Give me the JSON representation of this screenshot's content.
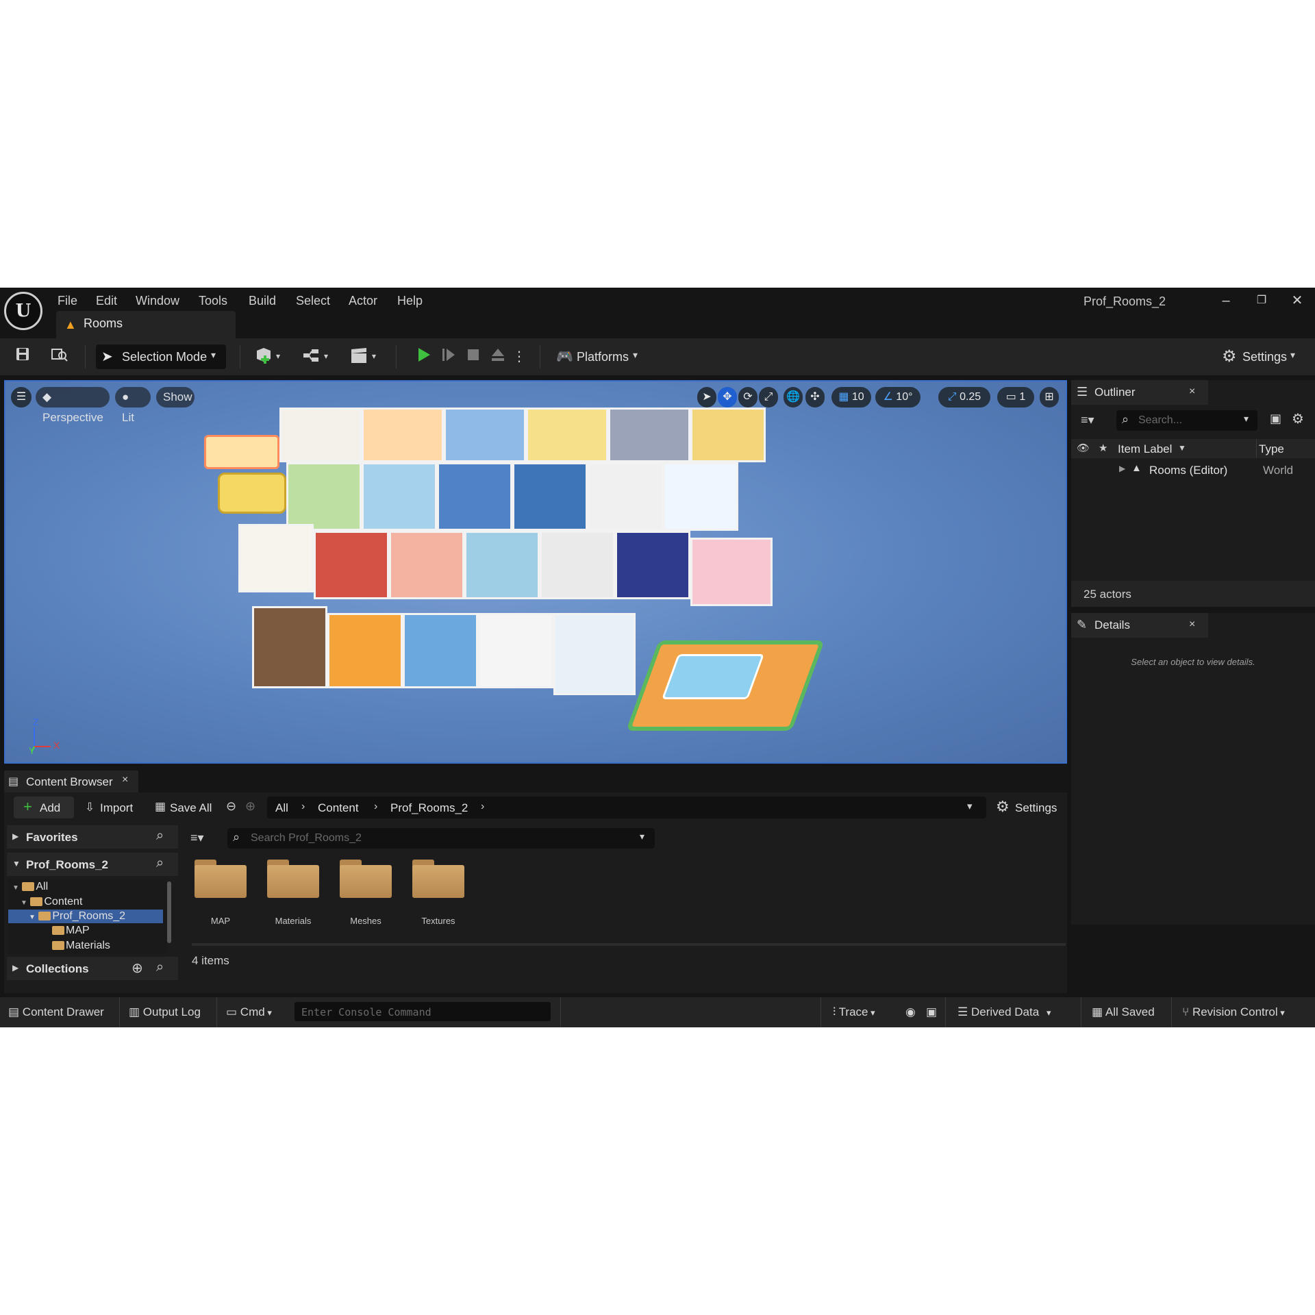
{
  "menu": {
    "items": [
      "File",
      "Edit",
      "Window",
      "Tools",
      "Build",
      "Select",
      "Actor",
      "Help"
    ]
  },
  "map_tab": {
    "label": "Rooms"
  },
  "window_title": "Prof_Rooms_2",
  "window_controls": {
    "minimize": "–",
    "restore": "❐",
    "close": "✕"
  },
  "toolbar": {
    "selection_mode": "Selection Mode",
    "platforms": "Platforms",
    "settings": "Settings"
  },
  "viewport": {
    "perspective": "Perspective",
    "lit": "Lit",
    "show": "Show",
    "grid_snap": "10",
    "rotation_snap": "10°",
    "scale_snap": "0.25",
    "camera_speed": "1",
    "axis": {
      "z": "Z",
      "y": "Y",
      "x": "X"
    }
  },
  "outliner": {
    "tab": "Outliner",
    "search_placeholder": "Search...",
    "col_item_label": "Item Label",
    "col_type": "Type",
    "row_label": "Rooms (Editor)",
    "row_type": "World",
    "footer": "25 actors"
  },
  "details": {
    "tab": "Details",
    "empty_message": "Select an object to view details."
  },
  "content_browser": {
    "tab": "Content Browser",
    "add": "Add",
    "import": "Import",
    "save_all": "Save All",
    "breadcrumb": [
      "All",
      "Content",
      "Prof_Rooms_2"
    ],
    "settings": "Settings",
    "favorites": "Favorites",
    "project": "Prof_Rooms_2",
    "search_placeholder": "Search Prof_Rooms_2",
    "tree": [
      "All",
      "Content",
      "Prof_Rooms_2",
      "MAP",
      "Materials"
    ],
    "collections": "Collections",
    "folders": [
      "MAP",
      "Materials",
      "Meshes",
      "Textures"
    ],
    "item_count": "4 items"
  },
  "statusbar": {
    "content_drawer": "Content Drawer",
    "output_log": "Output Log",
    "cmd": "Cmd",
    "console_placeholder": "Enter Console Command",
    "trace": "Trace",
    "derived_data": "Derived Data",
    "all_saved": "All Saved",
    "revision_control": "Revision Control"
  },
  "colors": {
    "editor_bg": "#151515",
    "panel_bg": "#1c1c1c",
    "toolbar_bg": "#242424",
    "viewport_sky": "#5f88c0",
    "accent_blue": "#1f5fcf",
    "play_green": "#3fbf3f",
    "folder": "#c79a5e"
  }
}
